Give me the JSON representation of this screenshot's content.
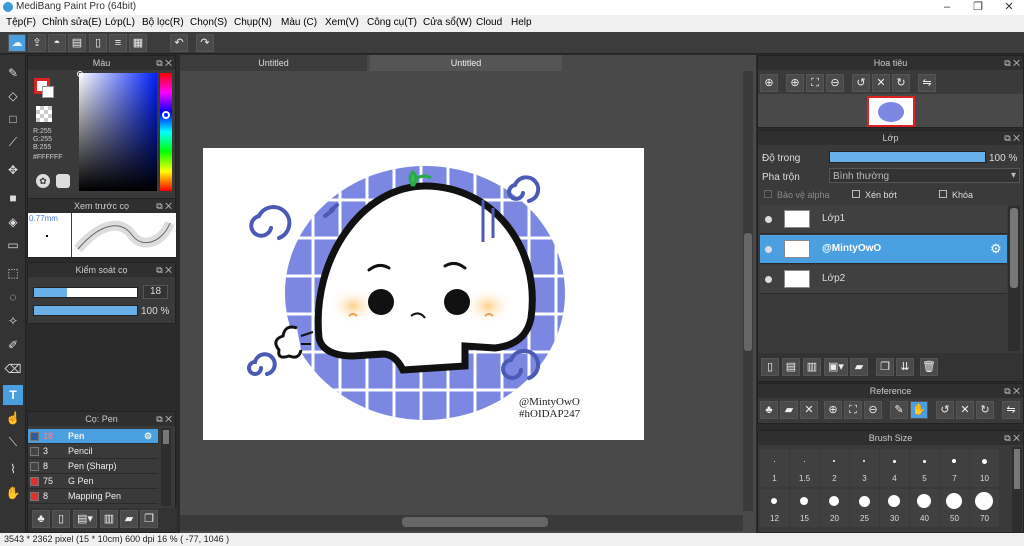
{
  "app": {
    "title": "MediBang Paint Pro (64bit)"
  },
  "menu": [
    "Tệp(F)",
    "Chỉnh sửa(E)",
    "Lớp(L)",
    "Bộ lọc(R)",
    "Chọn(S)",
    "Chụp(N)",
    "Màu (C)",
    "Xem(V)",
    "Công cụ(T)",
    "Cửa sổ(W)",
    "Cloud",
    "Help"
  ],
  "color_panel": {
    "title": "Màu",
    "r": "R:255",
    "g": "G:255",
    "b": "B:255",
    "hex": "#FFFFFF"
  },
  "preview_panel": {
    "title": "Xem trước cọ",
    "size": "0.77mm"
  },
  "brush_control": {
    "title": "Kiểm soát cọ",
    "size": "18",
    "opacity": "100 %",
    "size_fill": 0.32,
    "opacity_fill": 1.0
  },
  "brush_list": {
    "title": "Cọ: Pen",
    "items": [
      {
        "size": "18",
        "name": "Pen",
        "color": "#2e5d9a",
        "selected": true
      },
      {
        "size": "3",
        "name": "Pencil",
        "color": "#444444"
      },
      {
        "size": "8",
        "name": "Pen (Sharp)",
        "color": "#444444"
      },
      {
        "size": "75",
        "name": "G Pen",
        "color": "#e03030"
      },
      {
        "size": "8",
        "name": "Mapping Pen",
        "color": "#e03030"
      }
    ]
  },
  "tabs": [
    "Untitled",
    "Untitled"
  ],
  "canvas": {
    "watermark1": "@MintyOwO",
    "watermark2": "#hOIDAP247"
  },
  "navigator": {
    "title": "Hoa tiêu"
  },
  "layer_panel": {
    "title": "Lớp",
    "opacity_label": "Độ trong",
    "opacity_value": "100 %",
    "opacity_fill": 1.0,
    "blend_label": "Pha trộn",
    "blend_value": "Bình thường",
    "protect_alpha": "Bảo vệ alpha",
    "clipping": "Xén bớt",
    "lock": "Khóa",
    "layers": [
      {
        "name": "Lớp1",
        "selected": false
      },
      {
        "name": "@MintyOwO",
        "selected": true
      },
      {
        "name": "Lớp2",
        "selected": false
      }
    ]
  },
  "reference_panel": {
    "title": "Reference"
  },
  "brush_size_panel": {
    "title": "Brush Size",
    "sizes_row1": [
      "1",
      "1.5",
      "2",
      "3",
      "4",
      "5",
      "7",
      "10"
    ],
    "sizes_row2": [
      "12",
      "15",
      "20",
      "25",
      "30",
      "40",
      "50",
      "70"
    ]
  },
  "status": {
    "text": "3543 * 2362 pixel  (15 * 10cm)  600 dpi  16 %  ( -77, 1046 )"
  },
  "colors": {
    "accent": "#4a9fe0",
    "selected_layer": "#4a9fe0",
    "canvas_bg": "#ffffff",
    "grid_blue": "#7b87e0"
  }
}
